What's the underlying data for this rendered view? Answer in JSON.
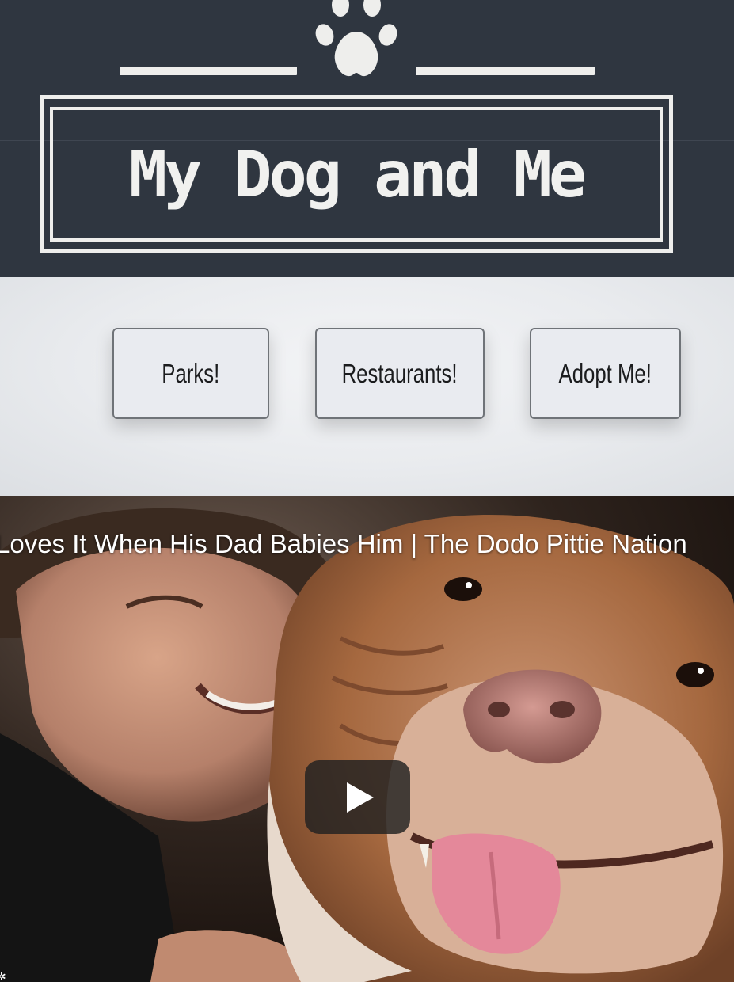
{
  "header": {
    "logo_text": "My Dog and Me",
    "logo_icon": "paw-icon",
    "background_color": "#2f3640",
    "logo_color": "#eeeeec"
  },
  "nav": {
    "buttons": [
      {
        "label": "Parks!"
      },
      {
        "label": "Restaurants!"
      },
      {
        "label": "Adopt Me!"
      }
    ]
  },
  "video": {
    "title": "Loves It When His Dad Babies Him | The Dodo Pittie Nation",
    "play_icon": "play-icon",
    "corner_icon": "settings-icon"
  }
}
